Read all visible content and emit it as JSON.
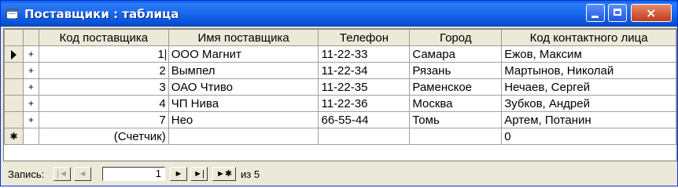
{
  "window": {
    "title": "Поставщики : таблица",
    "controls": {
      "minimize": "minimize",
      "maximize": "maximize",
      "close": "×"
    }
  },
  "table": {
    "columns": [
      "Код поставщика",
      "Имя поставщика",
      "Телефон",
      "Город",
      "Код контактного лица"
    ],
    "rows": [
      {
        "selector": "current",
        "expand": "+",
        "code": "1",
        "name": "ООО Магнит",
        "phone": "11-22-33",
        "city": "Самара",
        "contact": "Ежов, Максим"
      },
      {
        "selector": "",
        "expand": "+",
        "code": "2",
        "name": "Вымпел",
        "phone": "11-22-34",
        "city": "Рязань",
        "contact": "Мартынов, Николай"
      },
      {
        "selector": "",
        "expand": "+",
        "code": "3",
        "name": "ОАО Чтиво",
        "phone": "11-22-35",
        "city": "Раменское",
        "contact": "Нечаев, Сергей"
      },
      {
        "selector": "",
        "expand": "+",
        "code": "4",
        "name": "ЧП Нива",
        "phone": "11-22-36",
        "city": "Москва",
        "contact": "Зубков, Андрей"
      },
      {
        "selector": "",
        "expand": "+",
        "code": "7",
        "name": "Нео",
        "phone": "66-55-44",
        "city": "Томь",
        "contact": "Артем, Потанин"
      }
    ],
    "new_row": {
      "selector": "✱",
      "code": "(Счетчик)",
      "contact": "0"
    }
  },
  "status": {
    "label": "Запись:",
    "current_record": "1",
    "of_text": "из 5",
    "nav": {
      "first": "|◄",
      "prev": "◄",
      "next": "►",
      "last": "►|",
      "new": "►✱"
    }
  }
}
